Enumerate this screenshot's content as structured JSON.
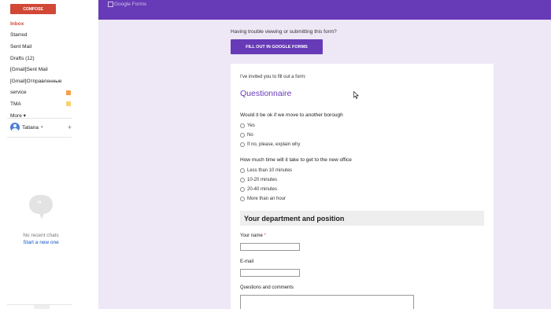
{
  "sidebar": {
    "compose_label": "COMPOSE",
    "items": [
      {
        "label": "Inbox",
        "active": true
      },
      {
        "label": "Starred"
      },
      {
        "label": "Sent Mail"
      },
      {
        "label": "Drafts (12)"
      },
      {
        "label": "[Gmail]Sent Mail"
      },
      {
        "label": "[Gmail]Отправленные"
      },
      {
        "label": "service",
        "color": "#f5a04a"
      },
      {
        "label": "TMA",
        "color": "#f7d26f"
      },
      {
        "label": "More ▾"
      }
    ],
    "user_name": "Tatiana",
    "no_chats": "No recent chats",
    "start_chat": "Start a new one"
  },
  "topbar": {
    "logo_alt": "Google Forms",
    "brand_color": "#673ab7"
  },
  "notice": {
    "trouble_text": "Having trouble viewing or submitting this form?",
    "fill_button": "FILL OUT IN GOOGLE FORMS"
  },
  "form": {
    "invited": "I've invited you to fill out a form:",
    "title": "Questionnaire",
    "questions": [
      {
        "title": "Would it be ok if we move to another borough",
        "options": [
          "Yes",
          "No",
          "If no, please, explain why"
        ]
      },
      {
        "title": "How much time will it take to get to the new office",
        "options": [
          "Less than 10 minutes",
          "10-20 minutes",
          "20-40 minutes",
          "More than an hour"
        ]
      }
    ],
    "section_title": "Your department and position",
    "fields": {
      "name_label": "Your name",
      "name_required": "*",
      "email_label": "E-mail",
      "comments_label": "Questions and comments"
    }
  },
  "icons": {
    "cursor": "arrow-cursor-icon",
    "chat": "chat-bubble-icon",
    "avatar": "user-avatar-icon"
  }
}
